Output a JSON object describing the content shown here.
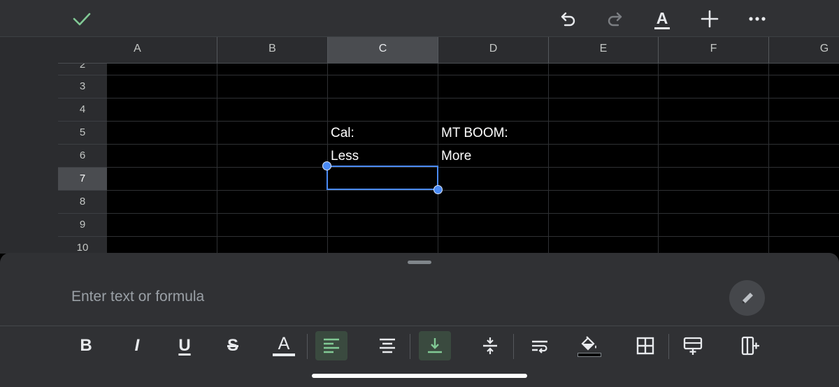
{
  "toolbar": {
    "confirm_icon": "checkmark-icon",
    "undo_icon": "undo-icon",
    "redo_icon": "redo-icon",
    "text_format_label": "A",
    "add_label": "+",
    "more_icon": "more-icon"
  },
  "columns": [
    "A",
    "B",
    "C",
    "D",
    "E",
    "F",
    "G"
  ],
  "selected_column": "C",
  "rows": [
    "2",
    "3",
    "4",
    "5",
    "6",
    "7",
    "8",
    "9",
    "10"
  ],
  "selected_row": "7",
  "cells": {
    "C5": "Cal:",
    "D5": "MT BOOM:",
    "C6": "Less",
    "D6": "More"
  },
  "formula_bar": {
    "placeholder": "Enter text or formula",
    "value": ""
  },
  "format_bar": {
    "bold_label": "B",
    "italic_label": "I",
    "underline_label": "U",
    "strikethrough_label": "S",
    "text_color_label": "A"
  },
  "colors": {
    "accent": "#4a8af4",
    "confirm": "#81c995",
    "active_format": "#81c995"
  }
}
